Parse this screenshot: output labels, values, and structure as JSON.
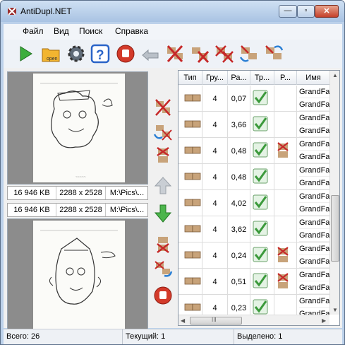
{
  "window": {
    "title": "AntiDupl.NET",
    "min_glyph": "—",
    "max_glyph": "▫",
    "close_glyph": "✕"
  },
  "menu": [
    "Файл",
    "Вид",
    "Поиск",
    "Справка"
  ],
  "toolbar": {
    "open_label": "open"
  },
  "left": {
    "info1": {
      "size": "16 946 KB",
      "dims": "2288 x 2528",
      "path": "M:\\Pics\\..."
    },
    "info2": {
      "size": "16 946 KB",
      "dims": "2288 x 2528",
      "path": "M:\\Pics\\..."
    }
  },
  "table": {
    "headers": [
      "Тип",
      "Гру...",
      "Ра...",
      "Тр...",
      "P...",
      "Имя"
    ],
    "rows": [
      {
        "group": "4",
        "diff": "0,07",
        "check": true,
        "del": false,
        "names": [
          "GrandFa",
          "GrandFa"
        ]
      },
      {
        "group": "4",
        "diff": "3,66",
        "check": true,
        "del": false,
        "names": [
          "GrandFa",
          "GrandFa"
        ]
      },
      {
        "group": "4",
        "diff": "0,48",
        "check": true,
        "del": true,
        "names": [
          "GrandFa",
          "GrandFa"
        ]
      },
      {
        "group": "4",
        "diff": "0,48",
        "check": true,
        "del": false,
        "names": [
          "GrandFa",
          "GrandFa"
        ]
      },
      {
        "group": "4",
        "diff": "4,02",
        "check": true,
        "del": false,
        "names": [
          "GrandFa",
          "GrandFa"
        ]
      },
      {
        "group": "4",
        "diff": "3,62",
        "check": true,
        "del": false,
        "names": [
          "GrandFa",
          "GrandFa"
        ]
      },
      {
        "group": "4",
        "diff": "0,24",
        "check": true,
        "del": true,
        "names": [
          "GrandFa",
          "GrandFa"
        ]
      },
      {
        "group": "4",
        "diff": "0,51",
        "check": true,
        "del": true,
        "names": [
          "GrandFa",
          "GrandFa"
        ]
      },
      {
        "group": "4",
        "diff": "0,23",
        "check": true,
        "del": false,
        "names": [
          "GrandFa",
          "GrandFa"
        ]
      }
    ],
    "hscroll_grip": "III"
  },
  "status": {
    "total": "Всего: 26",
    "current": "Текущий: 1",
    "selected": "Выделено: 1"
  },
  "colors": {
    "accent": "#bcd1ea",
    "check": "#3c9a3c",
    "delete": "#c62828"
  }
}
